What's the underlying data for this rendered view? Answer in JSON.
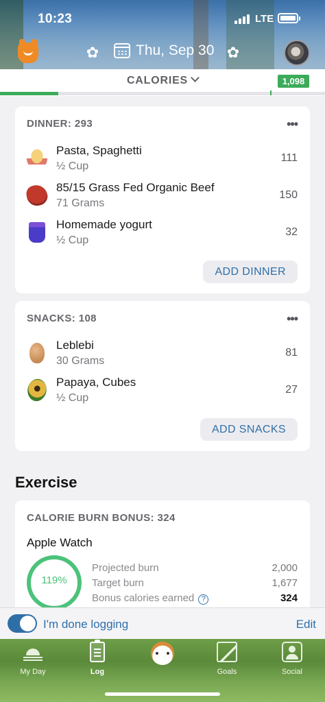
{
  "status_bar": {
    "time": "10:23",
    "network": "LTE"
  },
  "header": {
    "date": "Thu, Sep 30",
    "icons": [
      "logo-icon",
      "paw-icon",
      "calendar-icon",
      "paw-icon",
      "avatar"
    ]
  },
  "calorie_bar": {
    "title": "CALORIES",
    "remaining": "1,098",
    "progress_fraction": 0.18
  },
  "dinner": {
    "heading": "DINNER: 293",
    "items": [
      {
        "name": "Pasta, Spaghetti",
        "qty": "½ Cup",
        "cal": "111",
        "icon": "pasta-icon"
      },
      {
        "name": "85/15 Grass Fed Organic Beef",
        "qty": "71 Grams",
        "cal": "150",
        "icon": "beef-icon"
      },
      {
        "name": "Homemade yogurt",
        "qty": "½ Cup",
        "cal": "32",
        "icon": "yogurt-icon"
      }
    ],
    "add_label": "ADD DINNER"
  },
  "snacks": {
    "heading": "SNACKS: 108",
    "items": [
      {
        "name": "Leblebi",
        "qty": "30 Grams",
        "cal": "81",
        "icon": "chickpea-icon"
      },
      {
        "name": "Papaya, Cubes",
        "qty": "½ Cup",
        "cal": "27",
        "icon": "papaya-icon"
      }
    ],
    "add_label": "ADD SNACKS"
  },
  "exercise": {
    "title": "Exercise",
    "heading": "CALORIE BURN BONUS: 324",
    "source": "Apple Watch",
    "ring_percent": "119%",
    "rows": [
      {
        "label": "Projected burn",
        "value": "2,000"
      },
      {
        "label": "Target burn",
        "value": "1,677"
      },
      {
        "label": "Bonus calories earned",
        "value": "324"
      }
    ],
    "help": "?"
  },
  "done_bar": {
    "label": "I'm done logging",
    "toggle_on": true,
    "edit": "Edit"
  },
  "tabs": [
    {
      "label": "My Day",
      "icon": "sunrise-icon"
    },
    {
      "label": "Log",
      "icon": "log-icon",
      "active": true
    },
    {
      "label": "",
      "icon": "cat-icon"
    },
    {
      "label": "Goals",
      "icon": "goals-icon"
    },
    {
      "label": "Social",
      "icon": "social-icon"
    }
  ],
  "colors": {
    "accent": "#2f6fa8",
    "green": "#3cab5a",
    "ring": "#4cc27a"
  }
}
